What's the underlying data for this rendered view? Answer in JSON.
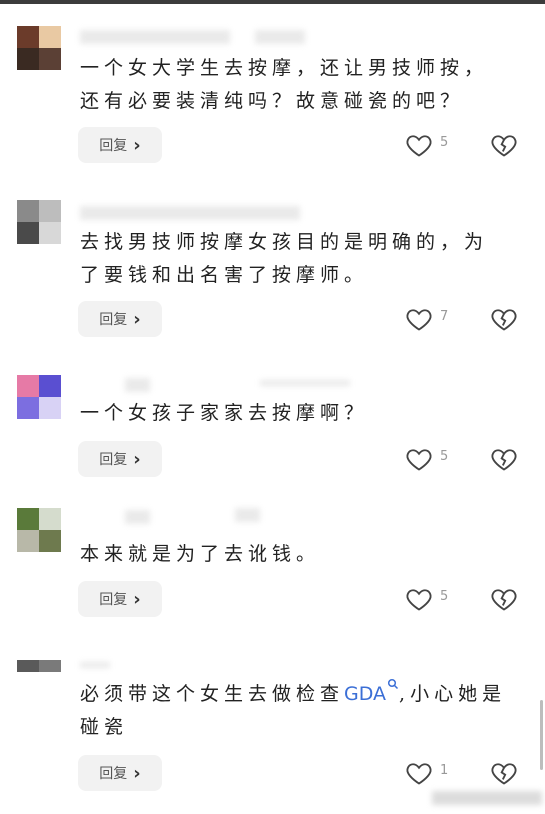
{
  "comments": [
    {
      "text": "一个女大学生去按摩，还让男技师按，还有必要装清纯吗？故意碰瓷的吧？",
      "reply_label": "回复",
      "likes": "5",
      "avatar_colors": [
        "#6b3b2a",
        "#e9c9a3",
        "#3a2a22",
        "#5b4035"
      ]
    },
    {
      "text": "去找男技师按摩女孩目的是明确的，为了要钱和出名害了按摩师。",
      "reply_label": "回复",
      "likes": "7",
      "avatar_colors": [
        "#8a8a8a",
        "#bdbdbd",
        "#4a4a4a",
        "#d8d8d8"
      ]
    },
    {
      "text": "一个女孩子家家去按摩啊？",
      "reply_label": "回复",
      "likes": "5",
      "avatar_colors": [
        "#e67aa6",
        "#5a4fd1",
        "#7c6ee0",
        "#d8d2f5"
      ]
    },
    {
      "text": "本来就是为了去讹钱。",
      "reply_label": "回复",
      "likes": "5",
      "avatar_colors": [
        "#5a7a3a",
        "#d5dccd",
        "#b8b8a8",
        "#6e7a4e"
      ]
    },
    {
      "text_before": "必须带这个女生去做检查",
      "search_term": "GDA",
      "text_after": ",小心她是碰瓷",
      "reply_label": "回复",
      "likes": "1",
      "avatar_colors": [
        "#5a5a5a",
        "#7a7a7a",
        "#ffffff",
        "#ffffff"
      ]
    }
  ]
}
